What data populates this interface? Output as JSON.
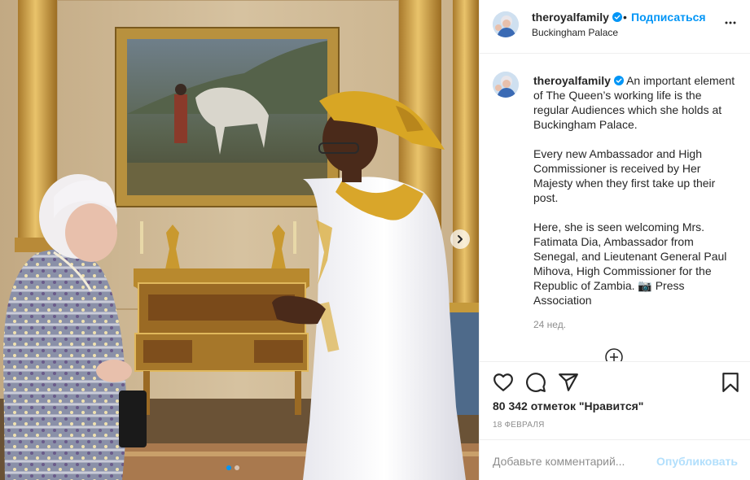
{
  "post": {
    "username": "theroyalfamily",
    "follow_label": "Подписаться",
    "separator": "•",
    "location": "Buckingham Palace",
    "caption": {
      "username": "theroyalfamily",
      "paragraph_1": "An important element of The Queen’s working life is the regular Audiences which she holds at Buckingham Palace.",
      "paragraph_2": "Every new Ambassador and High Commissioner is received by Her Majesty when they first take up their post.",
      "paragraph_3": "Here, she is seen welcoming Mrs. Fatimata Dia, Ambassador from Senegal, and Lieutenant General Paul Mihova, High Commissioner for the Republic of Zambia. 📷 Press Association"
    },
    "time_ago": "24 нед.",
    "likes": "80 342 отметок \"Нравится\"",
    "date": "18 ФЕВРАЛЯ",
    "comment_placeholder": "Добавьте комментарий...",
    "post_button": "Опубликовать"
  },
  "carousel": {
    "slide_count": 2,
    "active_slide": 1
  },
  "colors": {
    "link_blue": "#0095f6",
    "post_disabled": "#b2dffc",
    "muted": "#8e8e8e",
    "text": "#262626",
    "border": "#efefef"
  },
  "icons": {
    "like": "heart-icon",
    "comment": "comment-icon",
    "share": "paper-plane-icon",
    "save": "bookmark-icon",
    "more": "more-options-icon",
    "verified": "verified-badge-icon",
    "next": "chevron-right-icon",
    "load_more": "plus-circle-icon"
  }
}
